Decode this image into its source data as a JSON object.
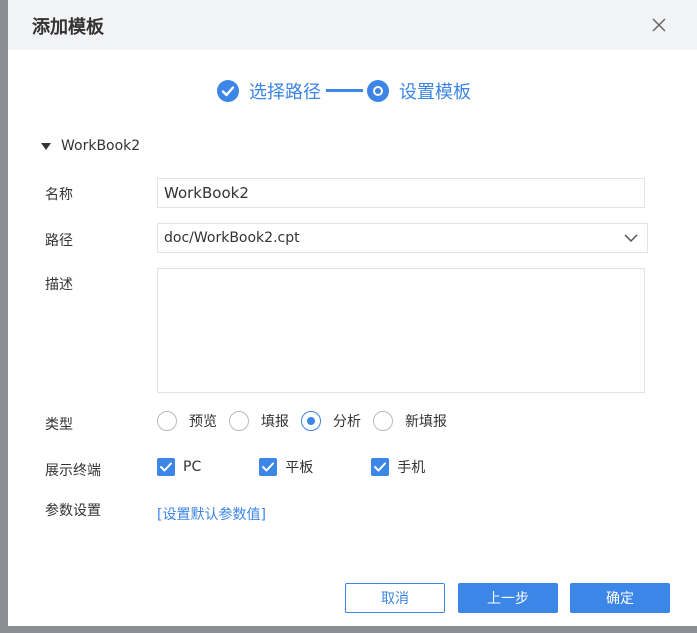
{
  "dialog": {
    "title": "添加模板"
  },
  "stepper": {
    "step1_label": "选择路径",
    "step2_label": "设置模板"
  },
  "tree": {
    "workbook_label": "WorkBook2"
  },
  "form": {
    "name_label": "名称",
    "name_value": "WorkBook2",
    "path_label": "路径",
    "path_value": "doc/WorkBook2.cpt",
    "desc_label": "描述",
    "desc_value": "",
    "type_label": "类型",
    "type_options": [
      {
        "label": "预览",
        "selected": false
      },
      {
        "label": "填报",
        "selected": false
      },
      {
        "label": "分析",
        "selected": true
      },
      {
        "label": "新填报",
        "selected": false
      }
    ],
    "terminal_label": "展示终端",
    "terminal_options": [
      {
        "label": "PC",
        "checked": true
      },
      {
        "label": "平板",
        "checked": true
      },
      {
        "label": "手机",
        "checked": true
      }
    ],
    "param_label": "参数设置",
    "param_link": "[设置默认参数值]"
  },
  "buttons": {
    "cancel": "取消",
    "prev": "上一步",
    "ok": "确定"
  },
  "colors": {
    "accent": "#3b86e6",
    "header_bg": "#f2f3f5",
    "backdrop": "#8a8d92"
  }
}
